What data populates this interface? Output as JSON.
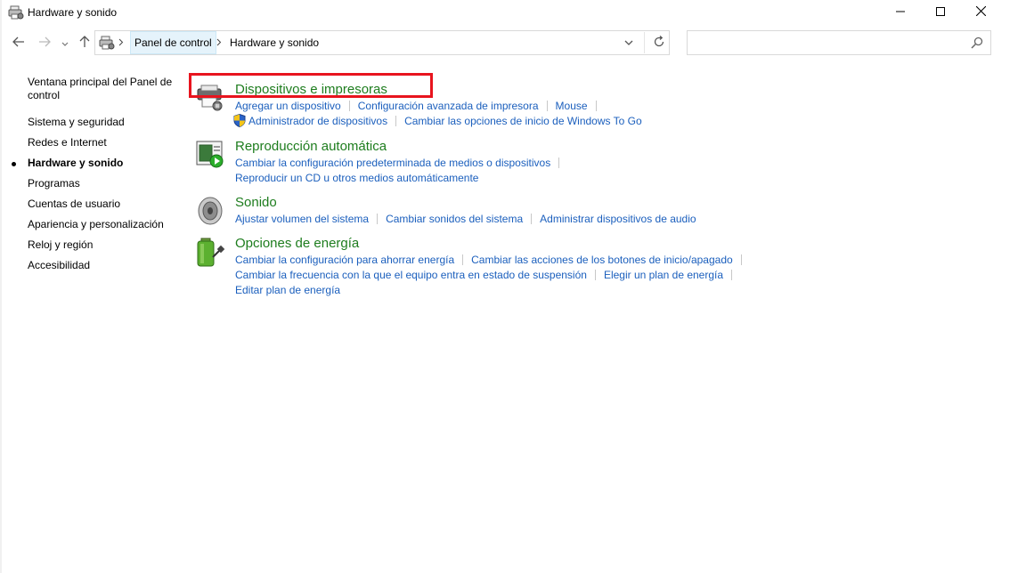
{
  "window": {
    "title": "Hardware y sonido",
    "controls": {
      "minimize": "minimize-icon",
      "maximize": "maximize-icon",
      "close": "close-icon"
    }
  },
  "address": {
    "breadcrumbs": [
      "Panel de control",
      "Hardware y sonido"
    ],
    "search_value": ""
  },
  "sidebar": {
    "items": [
      {
        "label": "Ventana principal del Panel de control",
        "active": false
      },
      {
        "label": "Sistema y seguridad",
        "active": false
      },
      {
        "label": "Redes e Internet",
        "active": false
      },
      {
        "label": "Hardware y sonido",
        "active": true
      },
      {
        "label": "Programas",
        "active": false
      },
      {
        "label": "Cuentas de usuario",
        "active": false
      },
      {
        "label": "Apariencia y personalización",
        "active": false
      },
      {
        "label": "Reloj y región",
        "active": false
      },
      {
        "label": "Accesibilidad",
        "active": false
      }
    ]
  },
  "categories": [
    {
      "title": "Dispositivos e impresoras",
      "icon": "printer-icon",
      "rows": [
        [
          "Agregar un dispositivo",
          "Configuración avanzada de impresora",
          "Mouse"
        ],
        [
          "Administrador de dispositivos",
          "Cambiar las opciones de inicio de Windows To Go"
        ]
      ]
    },
    {
      "title": "Reproducción automática",
      "icon": "autoplay-icon",
      "rows": [
        [
          "Cambiar la configuración predeterminada de medios o dispositivos"
        ],
        [
          "Reproducir un CD u otros medios automáticamente"
        ]
      ]
    },
    {
      "title": "Sonido",
      "icon": "speaker-icon",
      "rows": [
        [
          "Ajustar volumen del sistema",
          "Cambiar sonidos del sistema",
          "Administrar dispositivos de audio"
        ]
      ]
    },
    {
      "title": "Opciones de energía",
      "icon": "battery-power-icon",
      "rows": [
        [
          "Cambiar la configuración para ahorrar energía",
          "Cambiar las acciones de los botones de inicio/apagado"
        ],
        [
          "Cambiar la frecuencia con la que el equipo entra en estado de suspensión",
          "Elegir un plan de energía"
        ],
        [
          "Editar plan de energía"
        ]
      ]
    }
  ],
  "colors": {
    "category_title": "#1e7d1e",
    "link": "#1b5fbd",
    "highlight": "#e8141e",
    "breadcrumb_active_bg": "#e5f3fb"
  }
}
